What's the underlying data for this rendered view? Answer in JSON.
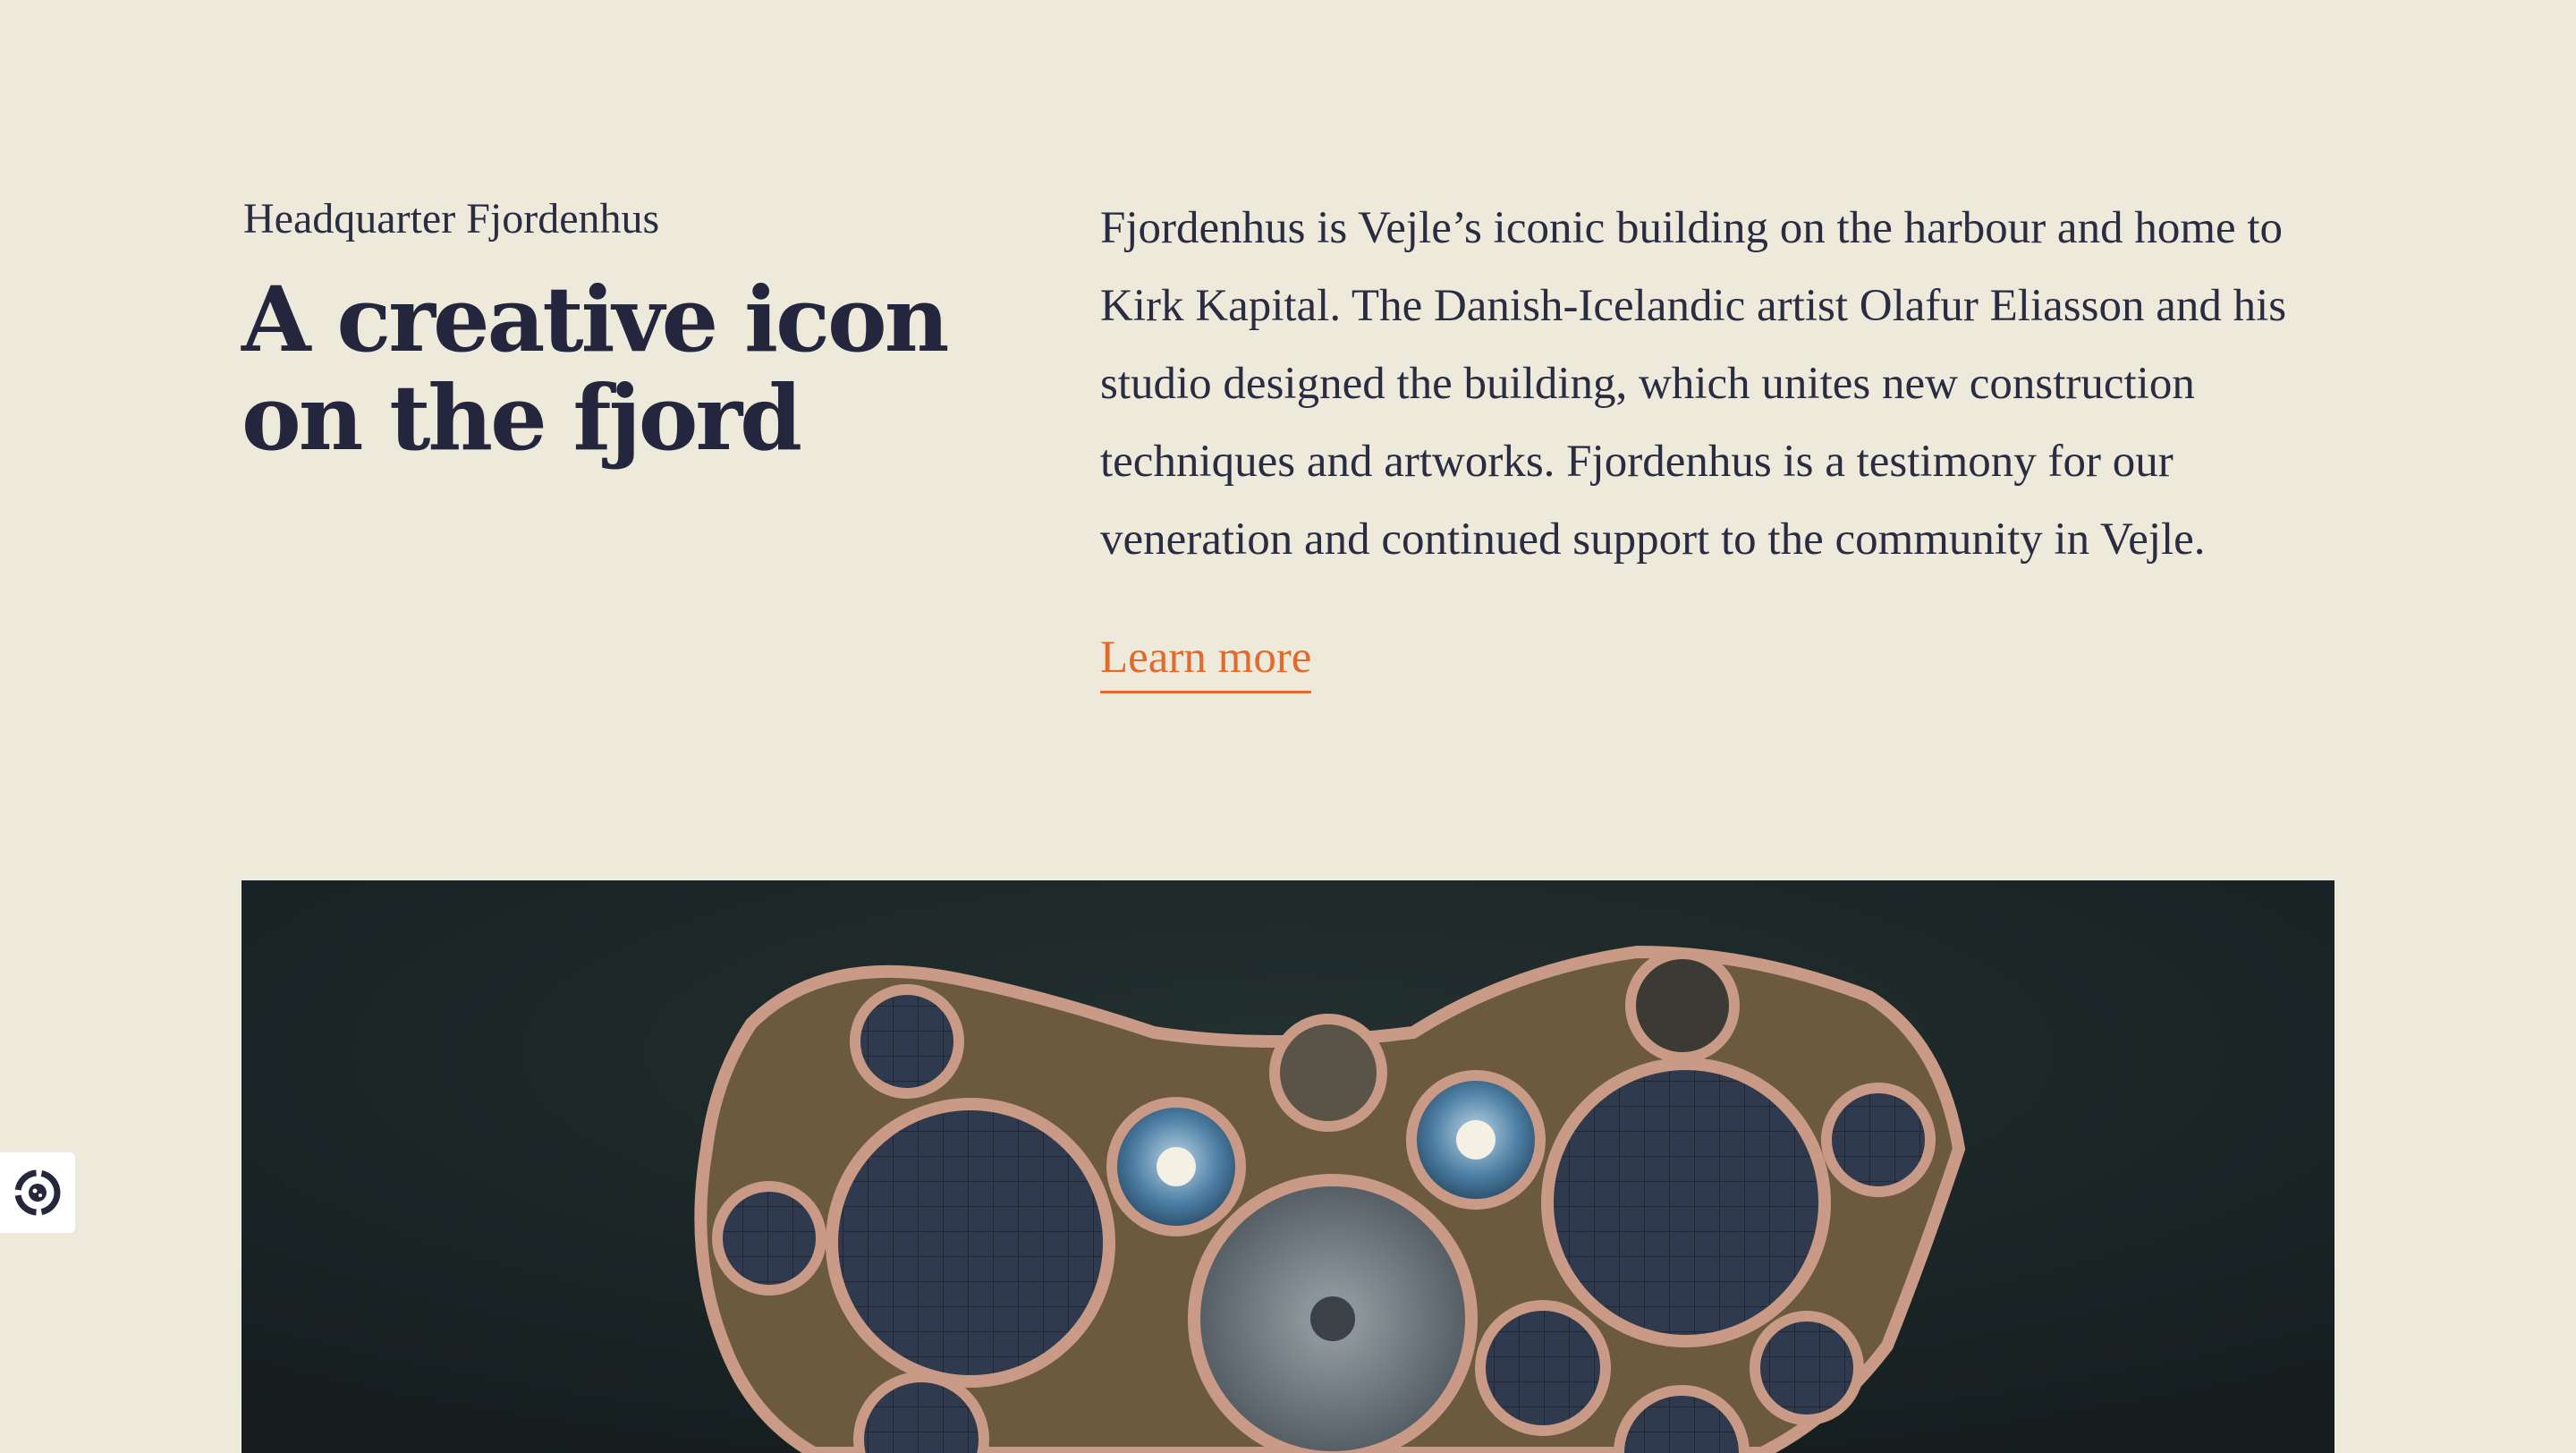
{
  "intro": {
    "eyebrow": "Headquarter Fjordenhus",
    "headline": "A creative icon on the fjord",
    "body": "Fjordenhus is Vejle’s iconic building on the harbour and home to Kirk Kapital. The Danish-Icelandic artist Olafur Eliasson and his studio designed the building, which unites new construction techniques and artworks. Fjordenhus is a testimony for our veneration and continued support to the community in Vejle.",
    "cta_label": "Learn more"
  },
  "hero_image": {
    "icon": "aerial-building-photo"
  },
  "cookie_widget": {
    "icon": "cookie-settings-icon"
  },
  "colors": {
    "background": "#edeadc",
    "text": "#25283d",
    "accent": "#e26a2c",
    "water": "#1c2626"
  }
}
